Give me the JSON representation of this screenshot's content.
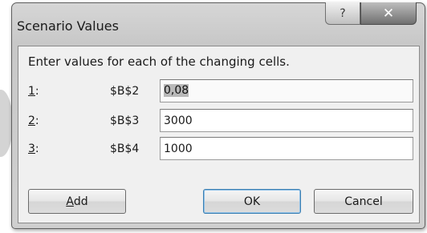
{
  "window": {
    "title": "Scenario Values",
    "help_glyph": "?",
    "close_glyph": "✕"
  },
  "instruction": "Enter values for each of the changing cells.",
  "rows": [
    {
      "accel": "1",
      "suffix": ":",
      "cell": "$B$2",
      "value": "0,08"
    },
    {
      "accel": "2",
      "suffix": ":",
      "cell": "$B$3",
      "value": "3000"
    },
    {
      "accel": "3",
      "suffix": ":",
      "cell": "$B$4",
      "value": "1000"
    }
  ],
  "buttons": {
    "add": {
      "accel": "A",
      "rest": "dd"
    },
    "ok": "OK",
    "cancel": "Cancel"
  },
  "icons": {
    "help": "help-icon",
    "close": "close-icon"
  }
}
